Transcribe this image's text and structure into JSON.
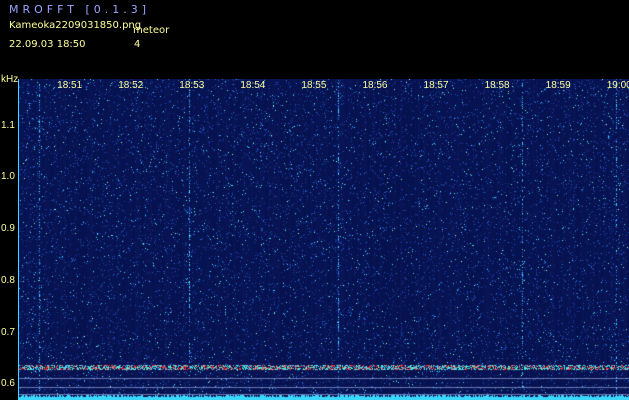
{
  "app": {
    "title": "MROFFT [0.1.3]",
    "filename": "Kameoka2209031850.png",
    "datetime": "22.09.03  18:50",
    "meteor_label": "meteor",
    "meteor_count": "4"
  },
  "spectrogram": {
    "unit": "kHz",
    "time_ticks": [
      "18:51",
      "18:52",
      "18:53",
      "18:54",
      "18:55",
      "18:56",
      "18:57",
      "18:58",
      "18:59",
      "19:00"
    ],
    "freq_ticks": [
      "1.1",
      "1.0",
      "0.9",
      "0.8",
      "0.7",
      "0.6"
    ],
    "freq_values": [
      1.1,
      1.0,
      0.9,
      0.8,
      0.7,
      0.6
    ],
    "freq_range": [
      0.57,
      1.19
    ],
    "time_minutes": [
      1,
      2,
      3,
      4,
      5,
      6,
      7,
      8,
      9,
      10
    ],
    "time_range": [
      0.17,
      10.16
    ],
    "colors": {
      "background": "#06104a",
      "noise": "#3ad8ff",
      "label": "#ffff9a",
      "title": "#9aa6ff",
      "echo": "#ff3030"
    }
  }
}
